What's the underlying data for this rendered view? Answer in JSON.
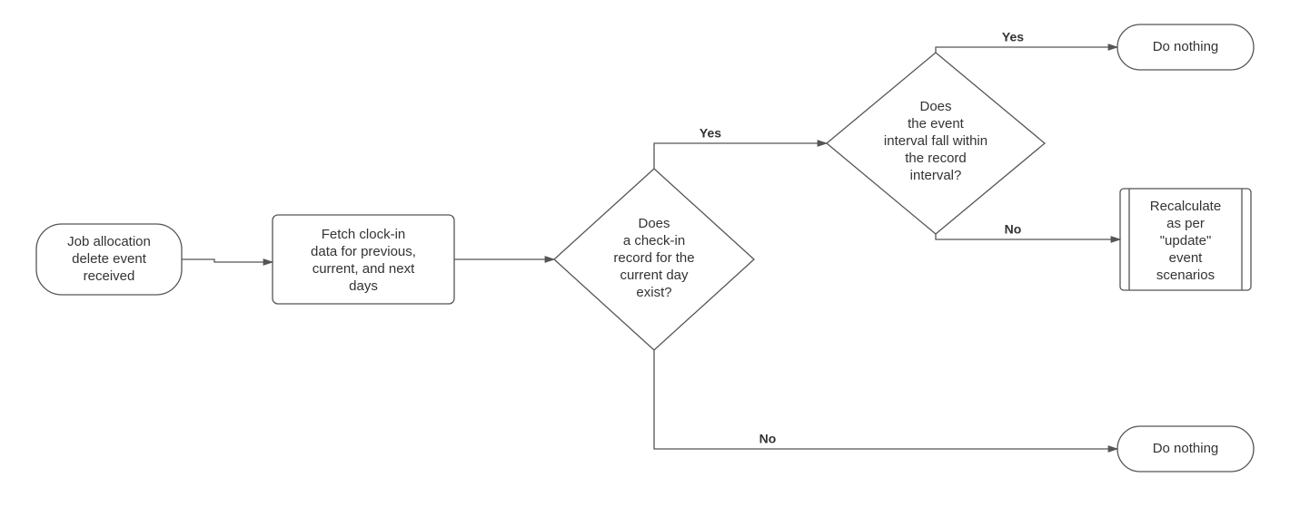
{
  "nodes": {
    "start": {
      "lines": [
        "Job allocation",
        "delete event",
        "received"
      ]
    },
    "fetch": {
      "lines": [
        "Fetch clock-in",
        "data for previous,",
        "current, and next",
        "days"
      ]
    },
    "checkinExists": {
      "lines": [
        "Does",
        "a check-in",
        "record for the",
        "current day",
        "exist?"
      ]
    },
    "intervalWithin": {
      "lines": [
        "Does",
        "the event",
        "interval fall within",
        "the record",
        "interval?"
      ]
    },
    "doNothingTop": {
      "lines": [
        "Do nothing"
      ]
    },
    "doNothingBottom": {
      "lines": [
        "Do nothing"
      ]
    },
    "recalculate": {
      "lines": [
        "Recalculate",
        "as per",
        "\"update\"",
        "event",
        "scenarios"
      ]
    }
  },
  "edgeLabels": {
    "yes": "Yes",
    "no": "No"
  },
  "chart_data": {
    "type": "flowchart",
    "nodes": [
      {
        "id": "start",
        "shape": "terminator",
        "text": "Job allocation delete event received"
      },
      {
        "id": "fetch",
        "shape": "process",
        "text": "Fetch clock-in data for previous, current, and next days"
      },
      {
        "id": "checkinExists",
        "shape": "decision",
        "text": "Does a check-in record for the current day exist?"
      },
      {
        "id": "intervalWithin",
        "shape": "decision",
        "text": "Does the event interval fall within the record interval?"
      },
      {
        "id": "doNothingTop",
        "shape": "terminator",
        "text": "Do nothing"
      },
      {
        "id": "recalculate",
        "shape": "predefined-process",
        "text": "Recalculate as per \"update\" event scenarios"
      },
      {
        "id": "doNothingBottom",
        "shape": "terminator",
        "text": "Do nothing"
      }
    ],
    "edges": [
      {
        "from": "start",
        "to": "fetch",
        "label": ""
      },
      {
        "from": "fetch",
        "to": "checkinExists",
        "label": ""
      },
      {
        "from": "checkinExists",
        "to": "intervalWithin",
        "label": "Yes"
      },
      {
        "from": "checkinExists",
        "to": "doNothingBottom",
        "label": "No"
      },
      {
        "from": "intervalWithin",
        "to": "doNothingTop",
        "label": "Yes"
      },
      {
        "from": "intervalWithin",
        "to": "recalculate",
        "label": "No"
      }
    ]
  }
}
